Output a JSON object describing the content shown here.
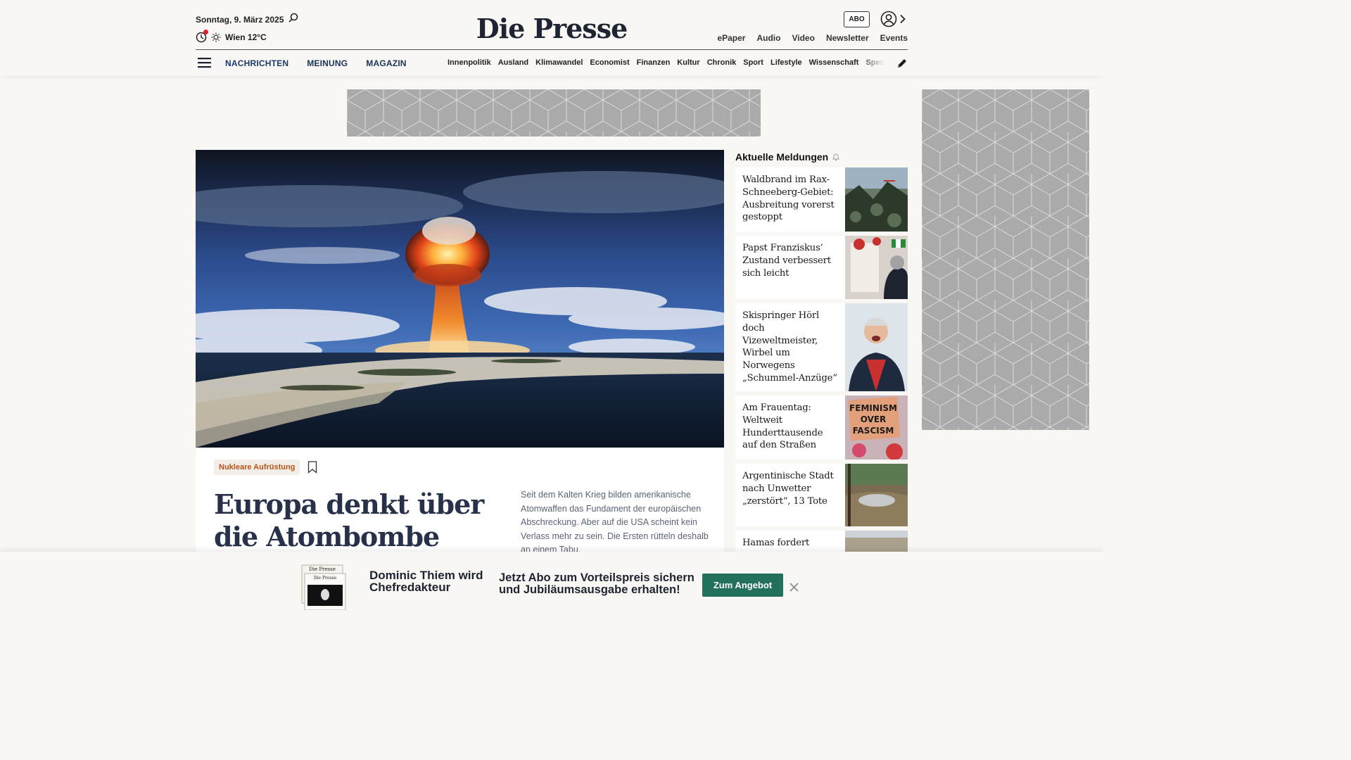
{
  "header": {
    "date": "Sonntag, 9. März 2025",
    "weather": "Wien 12°C",
    "logo": "Die Presse",
    "abo_label": "ABO",
    "util_nav": [
      "ePaper",
      "Audio",
      "Video",
      "Newsletter",
      "Events"
    ],
    "main_nav": [
      "NACHRICHTEN",
      "MEINUNG",
      "MAGAZIN"
    ],
    "sub_nav": [
      "Innenpolitik",
      "Ausland",
      "Klimawandel",
      "Economist",
      "Finanzen",
      "Kultur",
      "Chronik",
      "Sport",
      "Lifestyle",
      "Wissenschaft",
      "Spectrum"
    ],
    "icons": [
      "search-icon",
      "clock-icon",
      "sun-icon",
      "user-icon",
      "chevron-right-icon",
      "menu-icon",
      "pencil-icon"
    ]
  },
  "hero": {
    "tag": "Nukleare Aufrüstung",
    "headline": "Europa denkt über die Atombombe nach",
    "teaser": "Seit dem Kalten Krieg bilden amerikanische Atomwaffen das Fundament der europäischen Abschreckung. Aber auf die USA scheint kein Verlass mehr zu sein. Die Ersten rütteln deshalb an einem Tabu."
  },
  "sidebar": {
    "title": "Aktuelle Meldungen",
    "items": [
      {
        "text": "Waldbrand im Rax-Schneeberg-Gebiet: Ausbreitung vorerst gestoppt"
      },
      {
        "text": "Papst Franziskus’ Zustand verbessert sich leicht"
      },
      {
        "text": "Skispringer Hörl doch Vizeweltmeister, Wirbel um Norwegens „Schummel-Anzüge“"
      },
      {
        "text": "Am Frauentag: Weltweit Hunderttausende auf den Straßen"
      },
      {
        "text": "Argentinische Stadt nach Unwetter „zerstört“, 13 Tote"
      },
      {
        "text": "Hamas fordert"
      }
    ],
    "thumb4_sign": [
      "FEMINISM",
      "OVER",
      "FASCISM"
    ]
  },
  "promo": {
    "paper_logo": "Die Presse",
    "name": "Dominic Thiem wird Chefredakteur",
    "offer": "Jetzt Abo zum Vorteilspreis sichern und Jubiläumsausgabe erhalten!",
    "button": "Zum Angebot"
  },
  "colors": {
    "nav_blue": "#1a3a6e",
    "tag_orange": "#b5541a",
    "button_green": "#23705c",
    "notification_red": "#e0202b"
  }
}
